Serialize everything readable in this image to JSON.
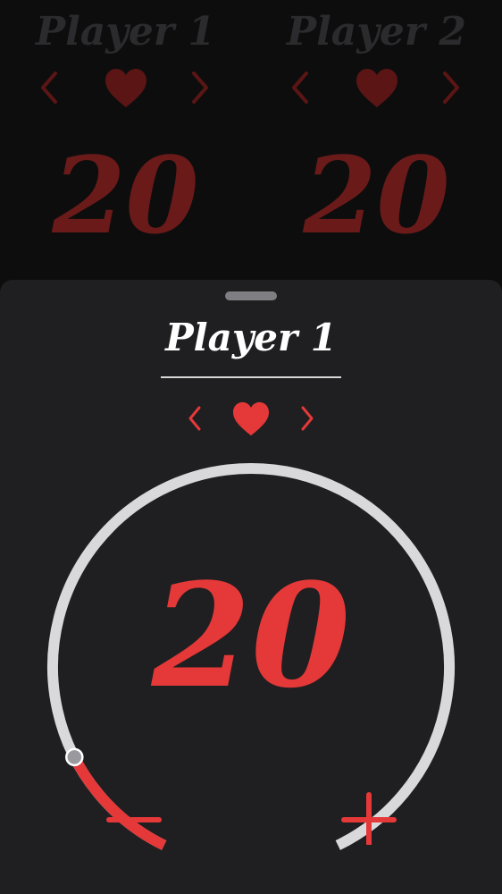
{
  "background_players": [
    {
      "name": "Player 1",
      "life": "20"
    },
    {
      "name": "Player 2",
      "life": "20"
    }
  ],
  "icons": {
    "prev": "chevron-left-icon",
    "next": "chevron-right-icon",
    "counter": "heart-icon",
    "decrement": "minus-icon",
    "increment": "plus-icon"
  },
  "sheet": {
    "player_name": "Player 1",
    "life": "20",
    "dial_fill_fraction": 0.12
  },
  "colors": {
    "accent": "#e53838",
    "dim_accent": "#6a1a19",
    "track": "#d9d9db",
    "sheet_bg": "#1f1f21",
    "background": "#0b0b0c"
  }
}
